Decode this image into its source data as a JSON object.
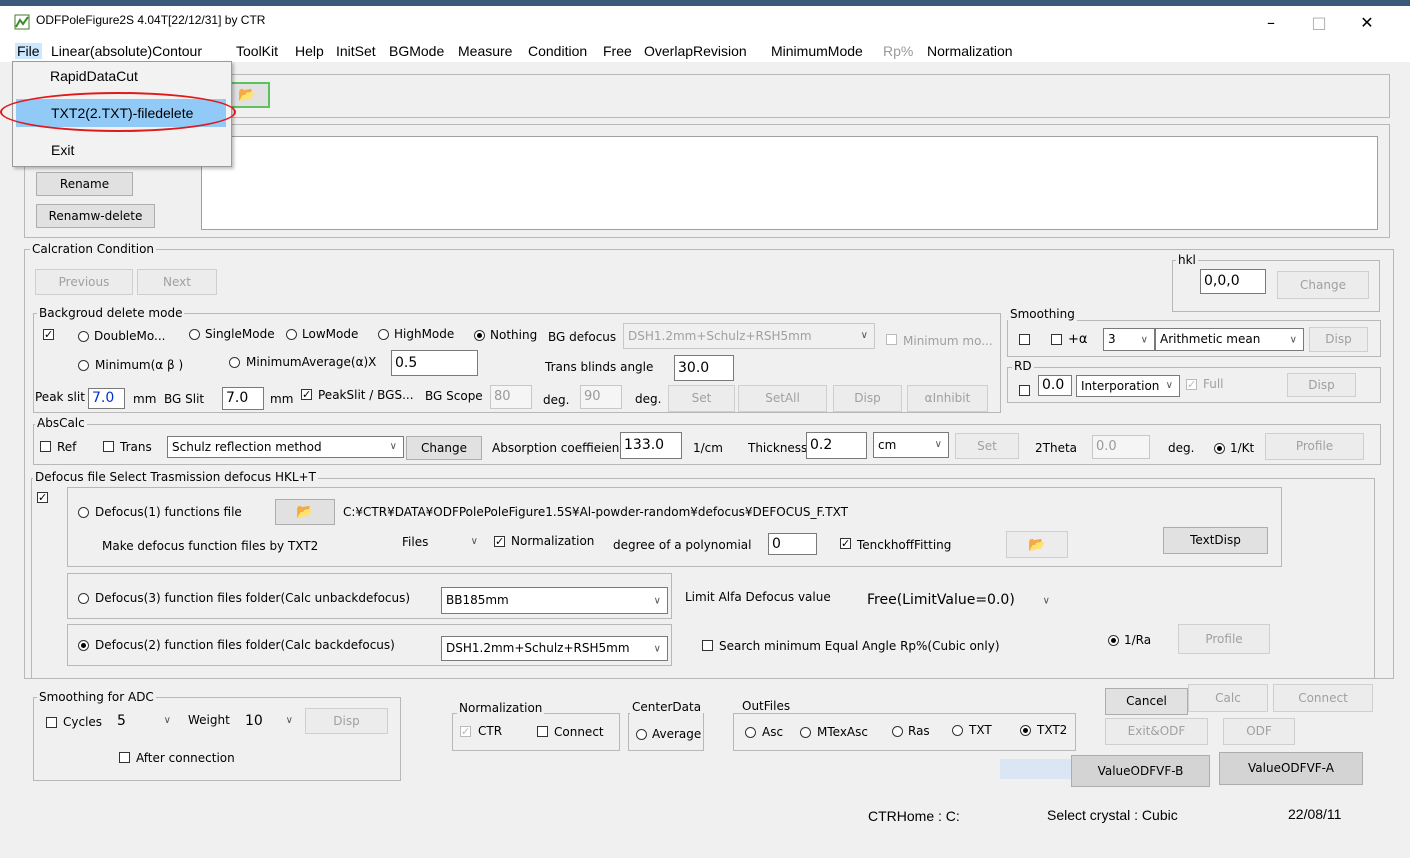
{
  "window": {
    "title": "ODFPoleFigure2S 4.04T[22/12/31] by CTR",
    "minimize": "–",
    "maximize": "□",
    "close": "✕"
  },
  "menubar": {
    "file": "File",
    "linear": "Linear(absolute)Contour",
    "toolkit": "ToolKit",
    "help": "Help",
    "initset": "InitSet",
    "bgmode": "BGMode",
    "measure": "Measure",
    "condition": "Condition",
    "free": "Free",
    "overlap": "OverlapRevision",
    "minimum": "MinimumMode",
    "rp": "Rp%",
    "normalization": "Normalization"
  },
  "file_menu": {
    "items": [
      "RapidDataCut",
      "TXT2(2.TXT)-filedelete",
      "Exit"
    ]
  },
  "file_panel": {
    "rename": "Rename",
    "renamw_delete": "Renamw-delete"
  },
  "calc": {
    "group_label": "Calcration Condition",
    "previous": "Previous",
    "next": "Next",
    "hkl_label": "hkl",
    "hkl_value": "0,0,0",
    "hkl_change": "Change"
  },
  "bg": {
    "group_label": "Backgroud delete mode",
    "double": "DoubleMo...",
    "single": "SingleMode",
    "low": "LowMode",
    "high": "HighMode",
    "nothing": "Nothing",
    "defocus_label": "BG defocus",
    "defocus_value": "DSH1.2mm+Schulz+RSH5mm",
    "minimum_mo": "Minimum mo...",
    "min_ab": "Minimum(α β )",
    "min_avg": "MinimumAverage(α)X",
    "min_avg_value": "0.5",
    "trans_blinds": "Trans blinds angle",
    "trans_blinds_value": "30.0",
    "peak_slit": "Peak slit",
    "peak_slit_value": "7.0",
    "mm1": "mm",
    "bg_slit": "BG Slit",
    "bg_slit_value": "7.0",
    "mm2": "mm",
    "peakslit_bgs": "PeakSlit / BGS...",
    "bg_scope": "BG Scope",
    "bg_scope_value": "80",
    "deg1": "deg.",
    "scope2_value": "90",
    "deg2": "deg.",
    "set": "Set",
    "setall": "SetAll",
    "disp": "Disp",
    "inhibit": "αInhibit"
  },
  "smoothing": {
    "label": "Smoothing",
    "plus_alpha": "+α",
    "count": "3",
    "method": "Arithmetic mean",
    "disp": "Disp"
  },
  "rd": {
    "label": "RD",
    "value": "0.0",
    "interp": "Interporation",
    "full": "Full",
    "disp": "Disp"
  },
  "abs": {
    "label": "AbsCalc",
    "ref": "Ref",
    "trans": "Trans",
    "method": "Schulz reflection method",
    "change": "Change",
    "abs_coeff_label": "Absorption coeffieien",
    "abs_coeff_value": "133.0",
    "unit": "1/cm",
    "thickness_label": "Thickness",
    "thickness_value": "0.2",
    "thickness_unit": "cm",
    "set": "Set",
    "two_theta": "2Theta",
    "two_theta_value": "0.0",
    "deg": "deg.",
    "kt": "1/Kt",
    "profile": "Profile"
  },
  "defocus": {
    "label": "Defocus file Select Trasmission defocus HKL+T",
    "def1": "Defocus(1) functions file",
    "def1_path": "C:¥CTR¥DATA¥ODFPolePoleFigure1.5S¥Al-powder-random¥defocus¥DEFOCUS_F.TXT",
    "make_txt2": "Make defocus function files by TXT2",
    "files": "Files",
    "normalization": "Normalization",
    "degree_poly": "degree of a polynomial",
    "degree_value": "0",
    "tenckhoff": "TenckhoffFitting",
    "textdisp": "TextDisp",
    "def3": "Defocus(3) function files folder(Calc unbackdefocus)",
    "def3_value": "BB185mm",
    "limit_alfa": "Limit Alfa Defocus value",
    "limit_value": "Free(LimitValue=0.0)",
    "def2": "Defocus(2) function files folder(Calc backdefocus)",
    "def2_value": "DSH1.2mm+Schulz+RSH5mm",
    "search_min": "Search minimum Equal Angle Rp%(Cubic only)",
    "ra": "1/Ra",
    "profile": "Profile"
  },
  "adc": {
    "label": "Smoothing for ADC",
    "cycles": "Cycles",
    "cycles_value": "5",
    "weight": "Weight",
    "weight_value": "10",
    "disp": "Disp",
    "after": "After connection"
  },
  "norm": {
    "label": "Normalization",
    "ctr": "CTR",
    "connect": "Connect"
  },
  "center": {
    "label": "CenterData",
    "average": "Average"
  },
  "outfiles": {
    "label": "OutFiles",
    "asc": "Asc",
    "mtex": "MTexAsc",
    "ras": "Ras",
    "txt": "TXT",
    "txt2": "TXT2"
  },
  "actions": {
    "cancel": "Cancel",
    "calc": "Calc",
    "connect": "Connect",
    "exit_odf": "Exit&ODF",
    "odf": "ODF",
    "value_b": "ValueODFVF-B",
    "value_a": "ValueODFVF-A"
  },
  "status": {
    "ctrhome": "CTRHome : C:",
    "crystal": "Select crystal : Cubic",
    "date": "22/08/11"
  }
}
